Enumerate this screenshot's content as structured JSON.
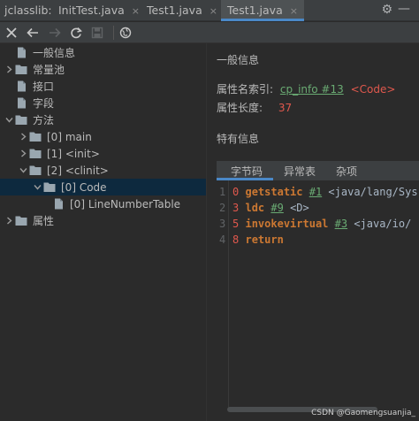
{
  "tabbar": {
    "title": "jclasslib:",
    "tabs": [
      {
        "label": "InitTest.java",
        "close": "×"
      },
      {
        "label": "Test1.java",
        "close": "×"
      },
      {
        "label": "Test1.java",
        "close": "×"
      }
    ],
    "active_tab_index": 2,
    "gear_icon": "⚙",
    "minimize_icon": "—"
  },
  "toolbar": {
    "buttons": [
      "close-icon",
      "back-icon",
      "forward-icon",
      "refresh-icon",
      "save-icon",
      "web-icon"
    ]
  },
  "tree": {
    "items": [
      {
        "label": "一般信息",
        "icon": "file-icon"
      },
      {
        "label": "常量池",
        "icon": "folder-icon",
        "arrow": "right"
      },
      {
        "label": "接口",
        "icon": "file-icon"
      },
      {
        "label": "字段",
        "icon": "file-icon"
      },
      {
        "label": "方法",
        "icon": "folder-icon",
        "arrow": "down"
      },
      {
        "label": "[0] main",
        "icon": "folder-icon",
        "arrow": "right"
      },
      {
        "label": "[1] <init>",
        "icon": "folder-icon",
        "arrow": "right"
      },
      {
        "label": "[2] <clinit>",
        "icon": "folder-icon",
        "arrow": "down"
      },
      {
        "label": "[0] Code",
        "icon": "folder-icon",
        "arrow": "down",
        "selected": true
      },
      {
        "label": "[0] LineNumberTable",
        "icon": "file-icon"
      },
      {
        "label": "属性",
        "icon": "folder-icon",
        "arrow": "right"
      }
    ]
  },
  "detail": {
    "general_title": "一般信息",
    "name_index_label": "属性名索引:",
    "name_index_link": "cp_info #13",
    "name_index_value": "<Code>",
    "length_label": "属性长度:",
    "length_value": "37",
    "specific_title": "特有信息",
    "subtabs": [
      "字节码",
      "异常表",
      "杂项"
    ],
    "code_lines": [
      {
        "ln": "1",
        "offset": "0",
        "op": "getstatic",
        "ref": "#1",
        "arg": "<java/lang/Sys"
      },
      {
        "ln": "2",
        "offset": "3",
        "op": "ldc",
        "ref": "#9",
        "arg": "<D>"
      },
      {
        "ln": "3",
        "offset": "5",
        "op": "invokevirtual",
        "ref": "#3",
        "arg": "<java/io/"
      },
      {
        "ln": "4",
        "offset": "8",
        "op": "return",
        "ref": "",
        "arg": ""
      }
    ]
  },
  "footer": "CSDN @Gaomengsuanjia_",
  "colors": {
    "accent": "#4a88c7",
    "selection": "#0d293e",
    "link_green": "#6aab73",
    "value_red": "#e0584d",
    "keyword": "#cc7832"
  }
}
